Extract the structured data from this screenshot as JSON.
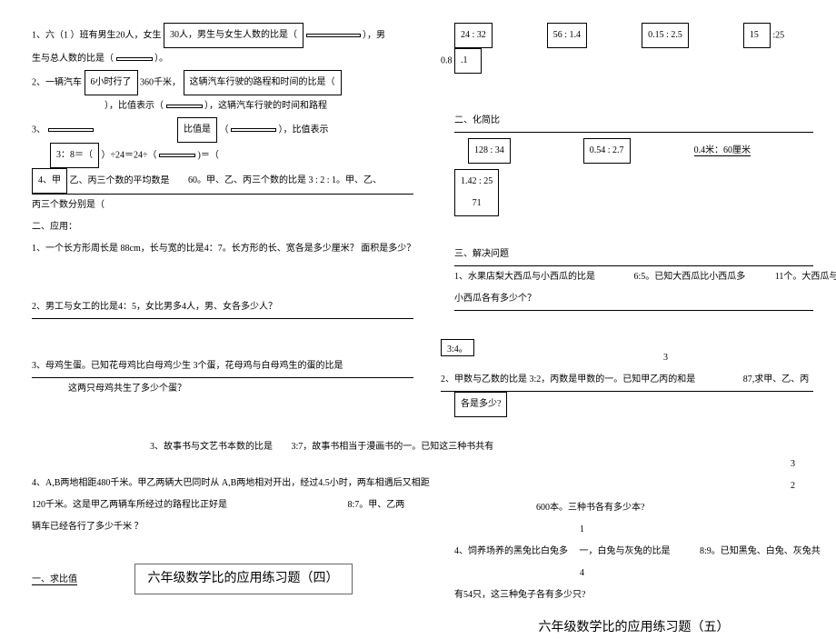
{
  "left": {
    "q1": "1、六（1 ）班有男生20人，女生",
    "q1b": "30人，男生与女生人数的比是（",
    "q1c": "），男",
    "q1d": "生与总人数的比是（",
    "q1e": "）。",
    "q2": "2、一辆汽车",
    "q2b": "6小时行了",
    "q2c": "360千米，",
    "q2d": "这辆汽车行驶的路程和时间的比是（",
    "q2e": "），比值表示（",
    "q2f": "），这辆汽车行驶的时间和路程",
    "q2g": "比值是",
    "q2h": "（",
    "q2i": "），比值表示",
    "q3": "3、",
    "q3a": "3：8＝（",
    "q3b": "）÷24＝24÷（",
    "q3c": ")＝（",
    "q4a": "4、甲",
    "q4b": "乙、丙三个数的平均数是",
    "q4c": "60。甲、乙、丙三个数的比是 3 : 2 : 1。甲、乙、",
    "q4d": "丙三个数分别是（",
    "sec2": "二、应用：",
    "q5": "1、一个长方形周长是 88cm，长与宽的比是4：7。长方形的长、宽各是多少厘米？ 面积是多少？",
    "q6": "2、男工与女工的比是4：5，女比男多4人，男、女各多少人？",
    "q7a": "3、母鸡生蛋。已知花母鸡比白母鸡少生 3个蛋，花母鸡与白母鸡生的蛋的比是",
    "q7b": "3:4。",
    "q7c": "这两只母鸡共生了多少个蛋？",
    "q8a": "3、故事书与文艺书本数的比是",
    "q8b": "3:7，故事书相当于漫画书的一。已知这三种书共有",
    "q9a": "4、A,B两地相距480千米。甲乙两辆大巴同时从 A,B两地相对开出，经过4.5小时，两车相遇后又相距",
    "q9b": "120千米。这是甲乙两辆车所经过的路程比正好是",
    "q9c": "8:7。甲、乙两",
    "q9d": "辆车已经各行了多少千米 ？",
    "footer_a": "一、求比值",
    "footer_title": "六年级数学比的应用练习题（四）"
  },
  "right": {
    "r1a": "24 : 32",
    "r1b": "56  : 1.4",
    "r1c": "0.15 : 2.5",
    "r1d": "15",
    "r1e": ":25",
    "r2a": "0.8",
    "r2b": ".1",
    "sec2": "二、化简比",
    "r3a": "128 : 34",
    "r3b": "0.54 : 2.7",
    "r3c": "0.4米：60厘米",
    "r4a": "1.42 : 25",
    "r4b": "71",
    "sec3": "三、解决问题",
    "r5a": "1、水果店梨大西瓜与小西瓜的比是",
    "r5b": "6:5。已知大西瓜比小西瓜多",
    "r5c": "11个。大西瓜与",
    "r5d": "小西瓜各有多少个？",
    "r6num": "3",
    "r6a": "2、甲数与乙数的比是 3:2，丙数是甲数的一。已知甲乙丙的和是",
    "r6b": "87,求甲、乙、丙",
    "r6c": "各是多少?",
    "r7num1": "3",
    "r7num2": "2",
    "r7a": "600本。三种书各有多少本?",
    "r8num1": "1",
    "r8a": "4、饲养场养的黑兔比白兔多",
    "r8b": "一，白兔与灰兔的比是",
    "r8c": "8:9。已知黑兔、白兔、灰兔共",
    "r8num2": "4",
    "r8d": "有54只，这三种兔子各有多少只?",
    "footer_title": "六年级数学比的应用练习题（五）"
  }
}
